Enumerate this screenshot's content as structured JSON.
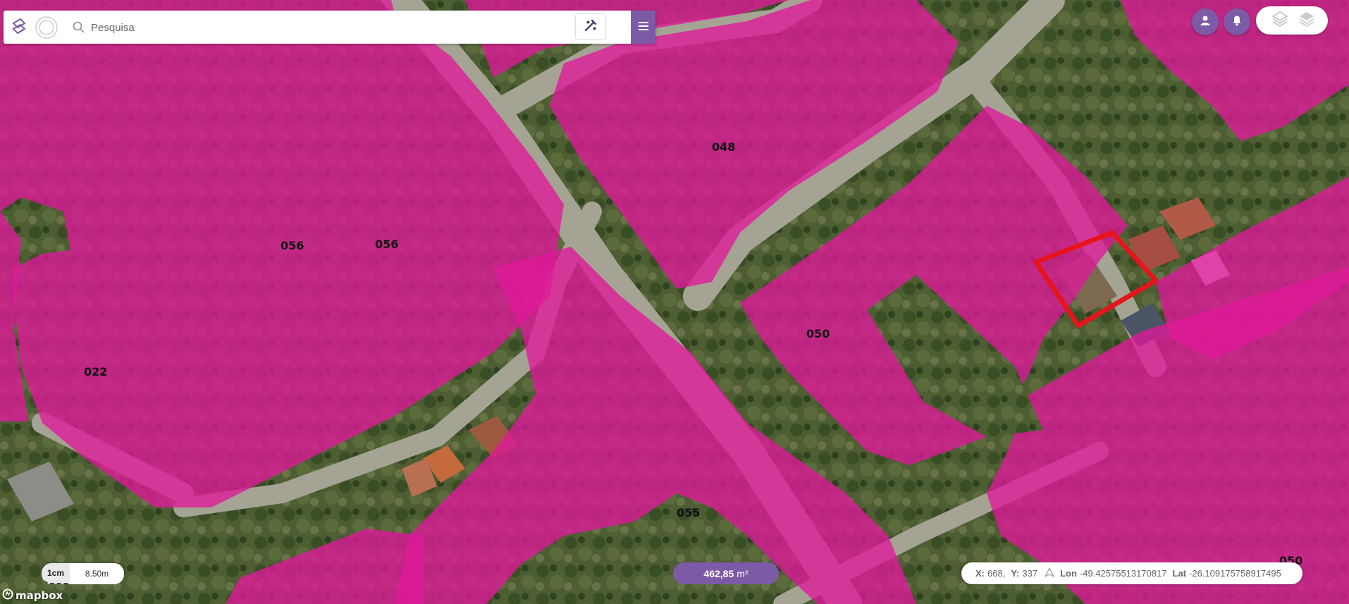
{
  "search": {
    "placeholder": "Pesquisa"
  },
  "map": {
    "parcel_labels": [
      "048",
      "056",
      "056",
      "022",
      "050",
      "055",
      "050"
    ],
    "colors": {
      "parcel_fill": "#e0189a",
      "selection": "#e6141c",
      "road": "#a7a697",
      "vegetation": "#3f5a2a"
    }
  },
  "scale": {
    "unit": "1cm",
    "value": "8.50m"
  },
  "area": {
    "value": "462,85",
    "unit": "m²"
  },
  "coords": {
    "x_label": "X:",
    "x_value": "668,",
    "y_label": "Y:",
    "y_value": "337",
    "lon_label": "Lon",
    "lon_value": "-49.42575513170817",
    "lat_label": "Lat",
    "lat_value": "-26.109175758917495"
  },
  "attribution": {
    "text": "mapbox"
  },
  "accent_color": "#7d5aa6",
  "icons": [
    "search-icon",
    "drawing-tools-icon",
    "hamburger-menu-icon",
    "user-icon",
    "bell-icon",
    "layers-outline-icon",
    "layers-filled-icon",
    "north-arrow-icon",
    "mapbox-logo-icon"
  ]
}
